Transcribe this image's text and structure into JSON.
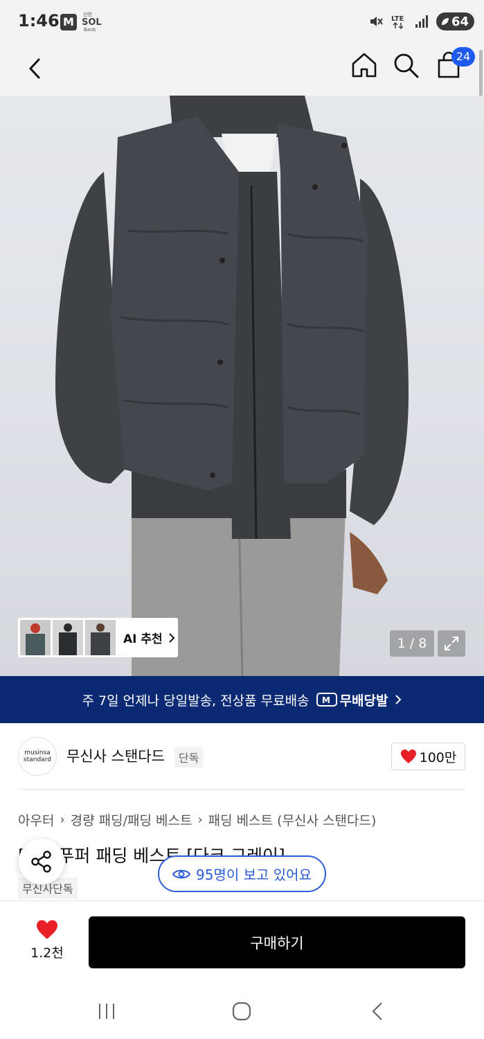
{
  "status_bar": {
    "time": "1:46",
    "m_badge": "M",
    "network": "LTE",
    "battery": "64"
  },
  "header": {
    "cart_count": "24"
  },
  "gallery": {
    "ai_label": "AI 추천",
    "counter": "1 / 8"
  },
  "promo": {
    "text": "주 7일 언제나 당일발송, 전상품 무료배송",
    "logo_text": "무배당발"
  },
  "brand": {
    "logo_line1": "musinsa",
    "logo_line2": "standard",
    "name": "무신사 스탠다드",
    "tag": "단독",
    "likes": "100만"
  },
  "breadcrumb": [
    "아우터",
    "경량 패딩/패딩 베스트",
    "패딩 베스트 (무신사 스탠다드)"
  ],
  "product": {
    "title": "[  ]리 푸퍼 패딩 베스트 [다크 그레이]",
    "exclusive_tag": "무신사단독"
  },
  "viewers": {
    "text": "95명이 보고 있어요"
  },
  "buy_bar": {
    "wish_count": "1.2천",
    "buy_label": "구매하기"
  },
  "colors": {
    "accent_blue": "#2b5bd8",
    "promo_navy": "#0b2a73",
    "heart_red": "#e8202a",
    "badge_blue": "#1e5af0"
  }
}
